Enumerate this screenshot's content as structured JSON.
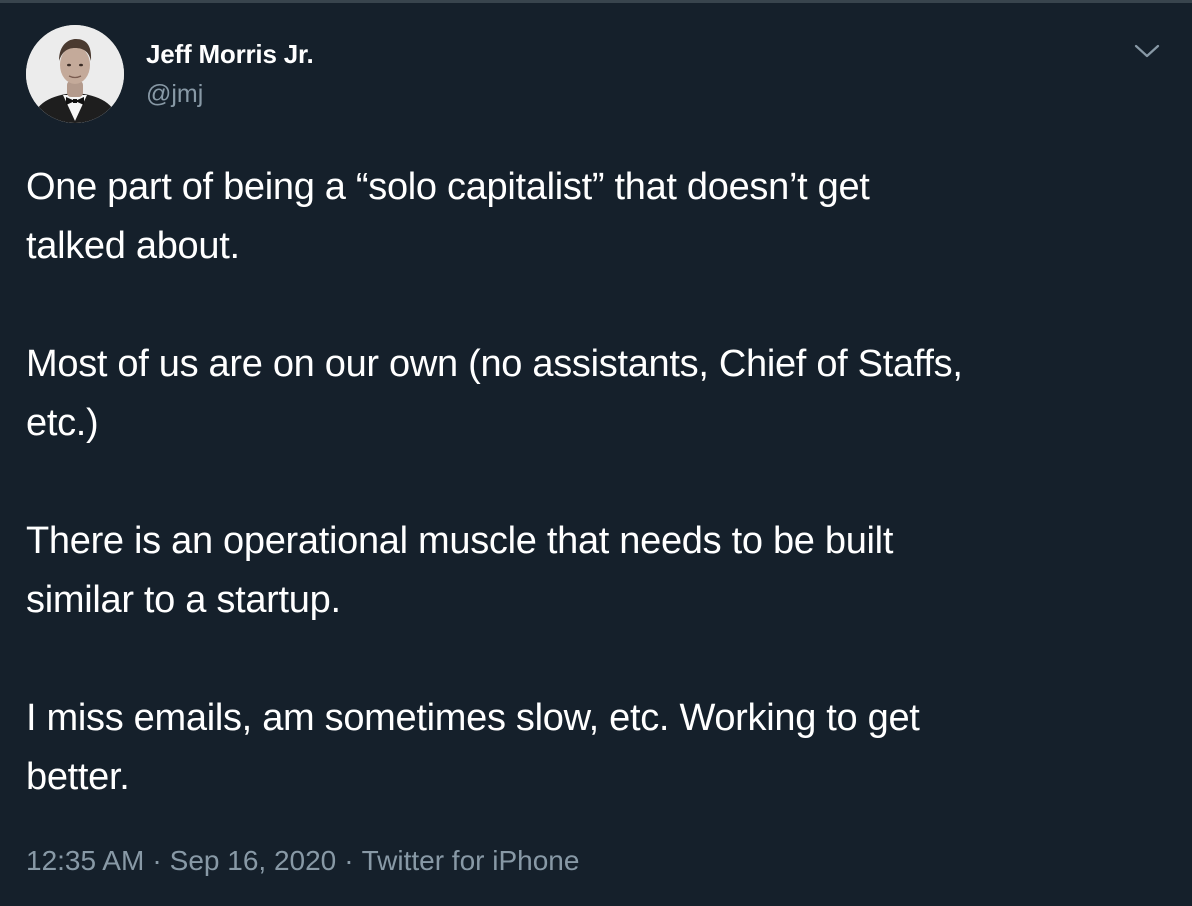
{
  "author": {
    "display_name": "Jeff Morris Jr.",
    "handle": "@jmj"
  },
  "tweet": {
    "paragraphs": [
      "One part of being a “solo capitalist” that doesn’t get\ntalked about.",
      "Most of us are on our own (no assistants, Chief of Staffs,\netc.)",
      "There is an operational muscle that needs to be built\nsimilar to a startup.",
      "I miss emails, am sometimes slow, etc. Working to get\nbetter."
    ],
    "time": "12:35 AM",
    "date": "Sep 16, 2020",
    "source": "Twitter for iPhone",
    "separator": "·"
  },
  "icons": {
    "menu": "chevron-down-icon"
  },
  "colors": {
    "background": "#15202b",
    "text": "#ffffff",
    "secondary": "#8899a6",
    "border": "#38444d"
  }
}
